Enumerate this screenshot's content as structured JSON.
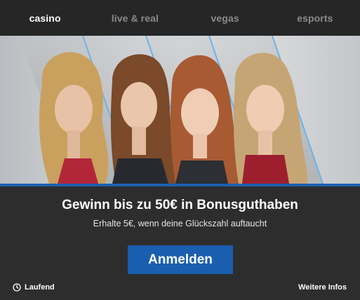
{
  "nav": {
    "tabs": [
      {
        "label": "casino",
        "active": true
      },
      {
        "label": "live & real",
        "active": false
      },
      {
        "label": "vegas",
        "active": false
      },
      {
        "label": "esports",
        "active": false
      }
    ]
  },
  "banner": {
    "image": "four-dealers-promo-image",
    "accent_color": "#1d5fb0"
  },
  "promo": {
    "headline": "Gewinn bis zu 50€ in Bonusguthaben",
    "subline": "Erhalte 5€, wenn deine Glückszahl auftaucht",
    "cta_label": "Anmelden",
    "cta_color": "#1a5eb0"
  },
  "footer": {
    "status_icon": "clock-icon",
    "status_label": "Laufend",
    "more_label": "Weitere Infos"
  }
}
